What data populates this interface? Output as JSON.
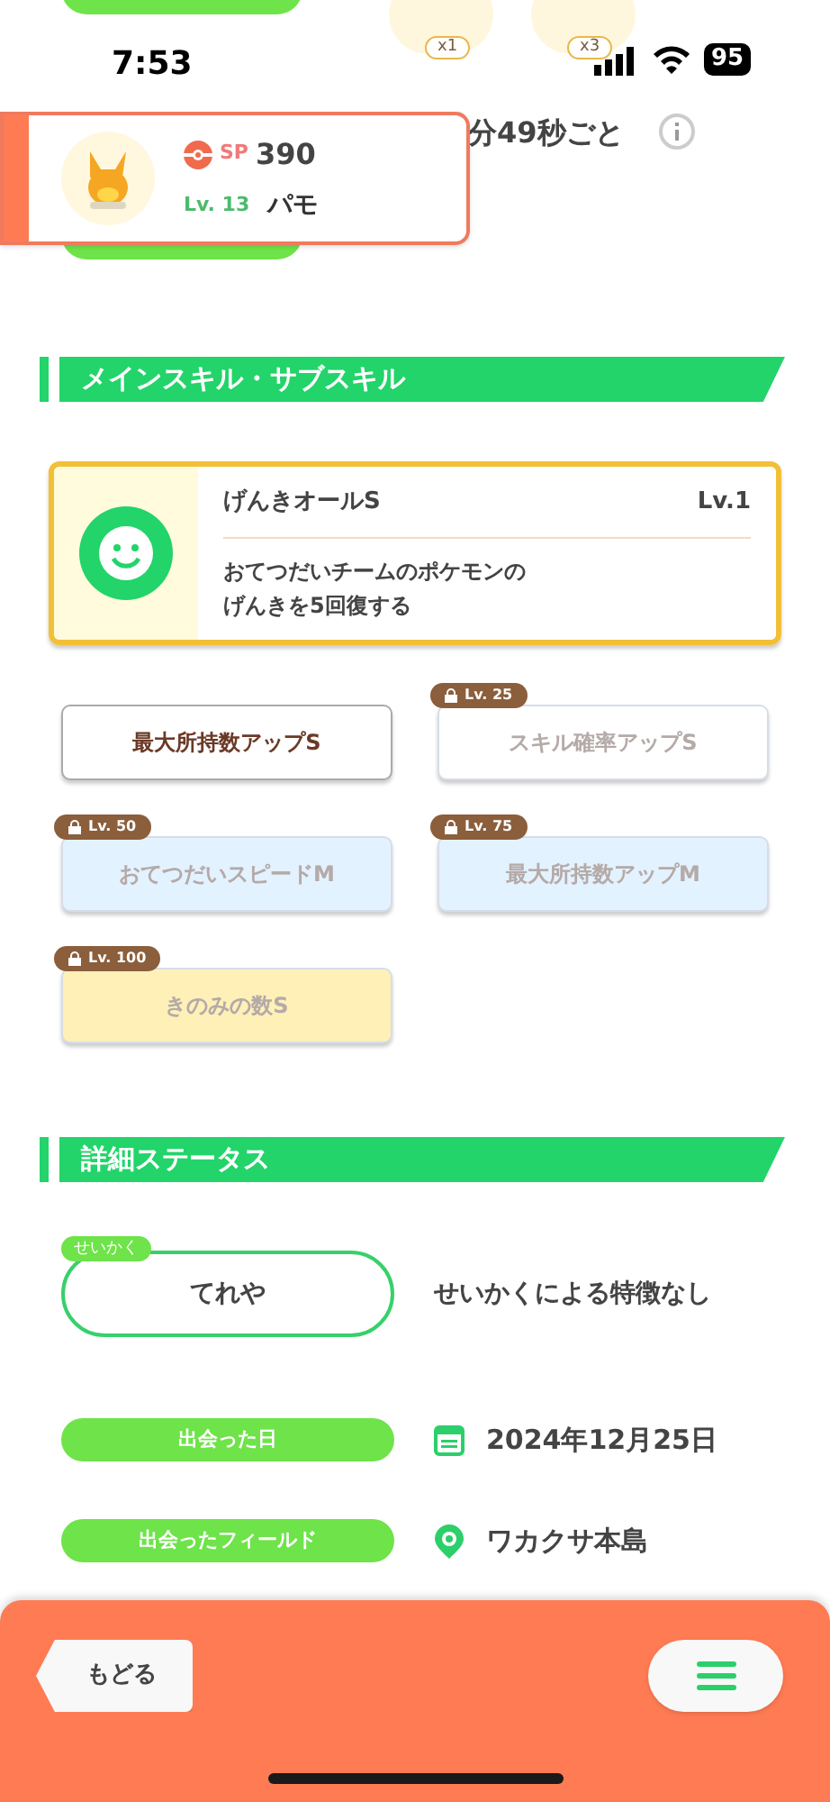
{
  "status_bar": {
    "time": "7:53",
    "battery": "95"
  },
  "behind": {
    "items": [
      {
        "count": "x1"
      },
      {
        "count": "x3"
      }
    ],
    "interval": "分49秒ごと"
  },
  "banner": {
    "sp_label": "SP",
    "sp": "390",
    "level": "Lv. 13",
    "name": "パモ"
  },
  "sections": [
    {
      "title": "メインスキル・サブスキル"
    },
    {
      "title": "詳細ステータス"
    }
  ],
  "main_skill": {
    "name": "げんきオールS",
    "level": "Lv.1",
    "description": [
      "おてつだいチームのポケモンの",
      "げんきを5回復する"
    ]
  },
  "sub_skills": [
    {
      "name": "最大所持数アップS",
      "locked": false,
      "color": "#ffffff"
    },
    {
      "name": "スキル確率アップS",
      "locked": true,
      "unlock": "Lv. 25",
      "color": "#ffffff"
    },
    {
      "name": "おてつだいスピードM",
      "locked": true,
      "unlock": "Lv. 50",
      "color": "#e3f2ff"
    },
    {
      "name": "最大所持数アップM",
      "locked": true,
      "unlock": "Lv. 75",
      "color": "#e3f2ff"
    },
    {
      "name": "きのみの数S",
      "locked": true,
      "unlock": "Lv. 100",
      "color": "#fff0b8"
    }
  ],
  "nature": {
    "label": "せいかく",
    "value": "てれや",
    "effect": "せいかくによる特徴なし"
  },
  "details": [
    {
      "kind": "date",
      "label": "出会った日",
      "value": "2024年12月25日"
    },
    {
      "kind": "field",
      "label": "出会ったフィールド",
      "value": "ワカクサ本島"
    }
  ],
  "footer": {
    "back": "もどる"
  }
}
